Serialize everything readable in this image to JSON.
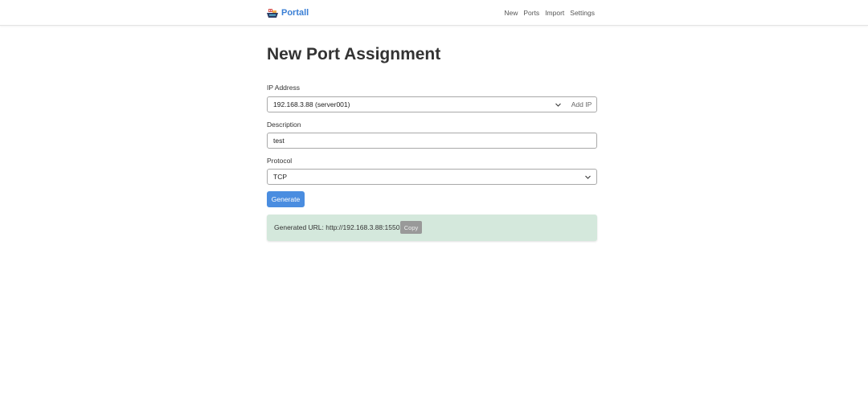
{
  "nav": {
    "brand": "Portall",
    "links": [
      "New",
      "Ports",
      "Import",
      "Settings"
    ]
  },
  "page": {
    "title": "New Port Assignment"
  },
  "form": {
    "ip_label": "IP Address",
    "ip_value": "192.168.3.88 (server001)",
    "add_ip_label": "Add IP",
    "description_label": "Description",
    "description_value": "test",
    "protocol_label": "Protocol",
    "protocol_value": "TCP",
    "generate_label": "Generate"
  },
  "result": {
    "text": "Generated URL: http://192.168.3.88:1550",
    "copy_label": "Copy"
  },
  "colors": {
    "accent": "#3a7fd5",
    "button": "#4a8de0",
    "result_bg": "#d4e8dc"
  }
}
